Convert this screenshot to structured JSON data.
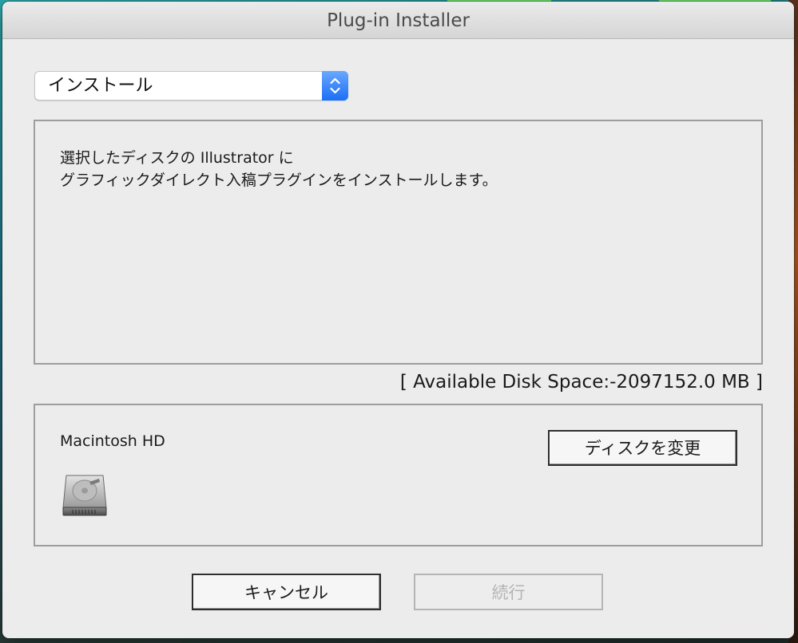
{
  "window": {
    "title": "Plug-in Installer"
  },
  "mode_select": {
    "value": "インストール",
    "stepper_icon": "up-down-chevron-icon"
  },
  "description": {
    "line1": "選択したディスクの Illustrator に",
    "line2": "グラフィックダイレクト入稿プラグインをインストールします。"
  },
  "disk_space": {
    "text": "[ Available Disk Space:-2097152.0 MB ]"
  },
  "disk": {
    "name": "Macintosh HD",
    "icon": "hard-drive-icon",
    "change_label": "ディスクを変更"
  },
  "actions": {
    "cancel_label": "キャンセル",
    "continue_label": "続行",
    "continue_enabled": false
  },
  "colors": {
    "dialog_bg": "#ececec",
    "accent_blue": "#1b6ef5",
    "border_gray": "#9d9d9d",
    "disabled_text": "#b4b4b4"
  }
}
